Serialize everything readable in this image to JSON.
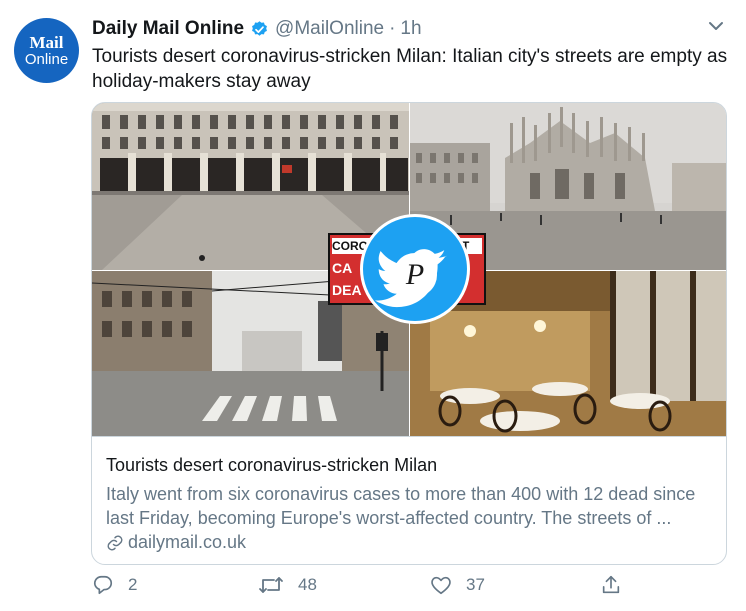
{
  "author": {
    "avatar_line1": "Mail",
    "avatar_line2": "Online",
    "name": "Daily Mail Online",
    "handle": "@MailOnline",
    "separator": "·",
    "time": "1h"
  },
  "tweet": {
    "text": "Tourists desert coronavirus-stricken Milan: Italian city's streets are empty as holiday-makers stay away"
  },
  "card": {
    "overlay": {
      "sign_left_lines": [
        "CORO",
        "CA",
        "DEA"
      ],
      "sign_right_line": "ST",
      "watermark_letter": "P"
    },
    "title": "Tourists desert coronavirus-stricken Milan",
    "description": "Italy went from six coronavirus cases to more than 400 with 12 dead since last Friday, becoming Europe's worst-affected country. The streets of ...",
    "link": "dailymail.co.uk"
  },
  "actions": {
    "replies": "2",
    "retweets": "48",
    "likes": "37"
  },
  "colors": {
    "verified": "#1da1f2",
    "avatar": "#1565c0",
    "muted": "#657786",
    "border": "#ccd6dd",
    "overlay_red": "#d32f2f"
  }
}
